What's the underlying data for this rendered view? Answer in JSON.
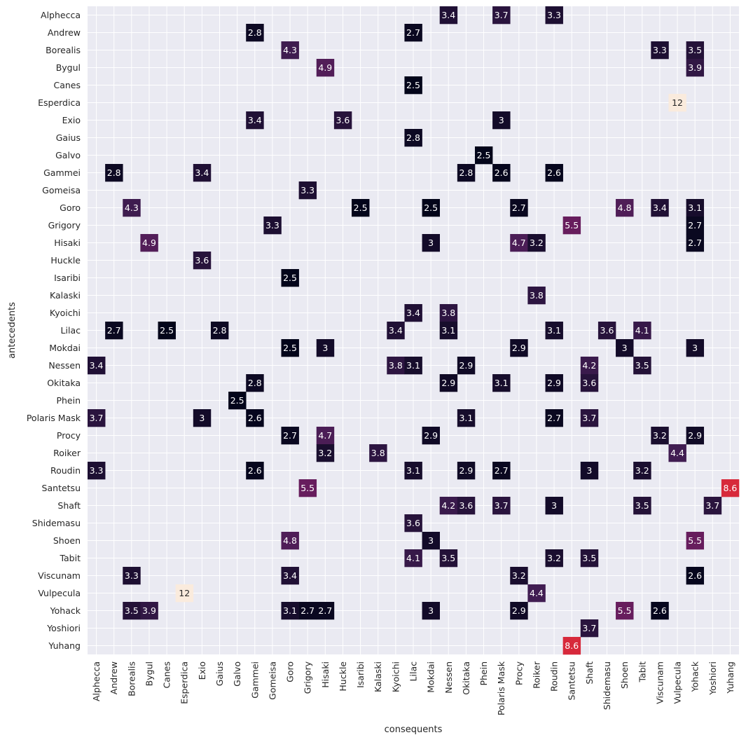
{
  "chart_data": {
    "type": "heatmap",
    "title": "",
    "xlabel": "consequents",
    "ylabel": "antecedents",
    "x_categories": [
      "Alphecca",
      "Andrew",
      "Borealis",
      "Bygul",
      "Canes",
      "Esperdica",
      "Exio",
      "Gaius",
      "Galvo",
      "Gammei",
      "Gomeisa",
      "Goro",
      "Grigory",
      "Hisaki",
      "Huckle",
      "Isaribi",
      "Kalaski",
      "Kyoichi",
      "Lilac",
      "Mokdai",
      "Nessen",
      "Okitaka",
      "Phein",
      "Polaris Mask",
      "Procy",
      "Roiker",
      "Roudin",
      "Santetsu",
      "Shaft",
      "Shidemasu",
      "Shoen",
      "Tabit",
      "Viscunam",
      "Vulpecula",
      "Yohack",
      "Yoshiori",
      "Yuhang"
    ],
    "y_categories": [
      "Alphecca",
      "Andrew",
      "Borealis",
      "Bygul",
      "Canes",
      "Esperdica",
      "Exio",
      "Gaius",
      "Galvo",
      "Gammei",
      "Gomeisa",
      "Goro",
      "Grigory",
      "Hisaki",
      "Huckle",
      "Isaribi",
      "Kalaski",
      "Kyoichi",
      "Lilac",
      "Mokdai",
      "Nessen",
      "Okitaka",
      "Phein",
      "Polaris Mask",
      "Procy",
      "Roiker",
      "Roudin",
      "Santetsu",
      "Shaft",
      "Shidemasu",
      "Shoen",
      "Tabit",
      "Viscunam",
      "Vulpecula",
      "Yohack",
      "Yoshiori",
      "Yuhang"
    ],
    "colormap": "rocket",
    "value_range": [
      2.5,
      12
    ],
    "colorbar": false,
    "grid": true,
    "cells": [
      {
        "y": "Alphecca",
        "x": "Nessen",
        "v": 3.4
      },
      {
        "y": "Alphecca",
        "x": "Polaris Mask",
        "v": 3.7
      },
      {
        "y": "Alphecca",
        "x": "Roudin",
        "v": 3.3
      },
      {
        "y": "Andrew",
        "x": "Gammei",
        "v": 2.8
      },
      {
        "y": "Andrew",
        "x": "Lilac",
        "v": 2.7
      },
      {
        "y": "Borealis",
        "x": "Goro",
        "v": 4.3
      },
      {
        "y": "Borealis",
        "x": "Viscunam",
        "v": 3.3
      },
      {
        "y": "Borealis",
        "x": "Yohack",
        "v": 3.5
      },
      {
        "y": "Bygul",
        "x": "Hisaki",
        "v": 4.9
      },
      {
        "y": "Bygul",
        "x": "Yohack",
        "v": 3.9
      },
      {
        "y": "Canes",
        "x": "Lilac",
        "v": 2.5
      },
      {
        "y": "Esperdica",
        "x": "Vulpecula",
        "v": 12
      },
      {
        "y": "Exio",
        "x": "Gammei",
        "v": 3.4
      },
      {
        "y": "Exio",
        "x": "Huckle",
        "v": 3.6
      },
      {
        "y": "Exio",
        "x": "Polaris Mask",
        "v": 3
      },
      {
        "y": "Gaius",
        "x": "Lilac",
        "v": 2.8
      },
      {
        "y": "Galvo",
        "x": "Phein",
        "v": 2.5
      },
      {
        "y": "Gammei",
        "x": "Andrew",
        "v": 2.8
      },
      {
        "y": "Gammei",
        "x": "Exio",
        "v": 3.4
      },
      {
        "y": "Gammei",
        "x": "Okitaka",
        "v": 2.8
      },
      {
        "y": "Gammei",
        "x": "Polaris Mask",
        "v": 2.6
      },
      {
        "y": "Gammei",
        "x": "Roudin",
        "v": 2.6
      },
      {
        "y": "Gomeisa",
        "x": "Grigory",
        "v": 3.3
      },
      {
        "y": "Goro",
        "x": "Borealis",
        "v": 4.3
      },
      {
        "y": "Goro",
        "x": "Isaribi",
        "v": 2.5
      },
      {
        "y": "Goro",
        "x": "Mokdai",
        "v": 2.5
      },
      {
        "y": "Goro",
        "x": "Procy",
        "v": 2.7
      },
      {
        "y": "Goro",
        "x": "Shoen",
        "v": 4.8
      },
      {
        "y": "Goro",
        "x": "Viscunam",
        "v": 3.4
      },
      {
        "y": "Goro",
        "x": "Yohack",
        "v": 3.1
      },
      {
        "y": "Grigory",
        "x": "Gomeisa",
        "v": 3.3
      },
      {
        "y": "Grigory",
        "x": "Santetsu",
        "v": 5.5
      },
      {
        "y": "Grigory",
        "x": "Yohack",
        "v": 2.7
      },
      {
        "y": "Hisaki",
        "x": "Bygul",
        "v": 4.9
      },
      {
        "y": "Hisaki",
        "x": "Mokdai",
        "v": 3
      },
      {
        "y": "Hisaki",
        "x": "Procy",
        "v": 4.7
      },
      {
        "y": "Hisaki",
        "x": "Roiker",
        "v": 3.2
      },
      {
        "y": "Hisaki",
        "x": "Yohack",
        "v": 2.7
      },
      {
        "y": "Huckle",
        "x": "Exio",
        "v": 3.6
      },
      {
        "y": "Isaribi",
        "x": "Goro",
        "v": 2.5
      },
      {
        "y": "Kalaski",
        "x": "Roiker",
        "v": 3.8
      },
      {
        "y": "Kyoichi",
        "x": "Lilac",
        "v": 3.4
      },
      {
        "y": "Kyoichi",
        "x": "Nessen",
        "v": 3.8
      },
      {
        "y": "Lilac",
        "x": "Andrew",
        "v": 2.7
      },
      {
        "y": "Lilac",
        "x": "Canes",
        "v": 2.5
      },
      {
        "y": "Lilac",
        "x": "Gaius",
        "v": 2.8
      },
      {
        "y": "Lilac",
        "x": "Kyoichi",
        "v": 3.4
      },
      {
        "y": "Lilac",
        "x": "Nessen",
        "v": 3.1
      },
      {
        "y": "Lilac",
        "x": "Roudin",
        "v": 3.1
      },
      {
        "y": "Lilac",
        "x": "Shidemasu",
        "v": 3.6
      },
      {
        "y": "Lilac",
        "x": "Tabit",
        "v": 4.1
      },
      {
        "y": "Mokdai",
        "x": "Goro",
        "v": 2.5
      },
      {
        "y": "Mokdai",
        "x": "Hisaki",
        "v": 3
      },
      {
        "y": "Mokdai",
        "x": "Procy",
        "v": 2.9
      },
      {
        "y": "Mokdai",
        "x": "Shoen",
        "v": 3
      },
      {
        "y": "Mokdai",
        "x": "Yohack",
        "v": 3
      },
      {
        "y": "Nessen",
        "x": "Alphecca",
        "v": 3.4
      },
      {
        "y": "Nessen",
        "x": "Kyoichi",
        "v": 3.8
      },
      {
        "y": "Nessen",
        "x": "Lilac",
        "v": 3.1
      },
      {
        "y": "Nessen",
        "x": "Okitaka",
        "v": 2.9
      },
      {
        "y": "Nessen",
        "x": "Shaft",
        "v": 4.2
      },
      {
        "y": "Nessen",
        "x": "Tabit",
        "v": 3.5
      },
      {
        "y": "Okitaka",
        "x": "Gammei",
        "v": 2.8
      },
      {
        "y": "Okitaka",
        "x": "Nessen",
        "v": 2.9
      },
      {
        "y": "Okitaka",
        "x": "Polaris Mask",
        "v": 3.1
      },
      {
        "y": "Okitaka",
        "x": "Roudin",
        "v": 2.9
      },
      {
        "y": "Okitaka",
        "x": "Shaft",
        "v": 3.6
      },
      {
        "y": "Phein",
        "x": "Galvo",
        "v": 2.5
      },
      {
        "y": "Polaris Mask",
        "x": "Alphecca",
        "v": 3.7
      },
      {
        "y": "Polaris Mask",
        "x": "Exio",
        "v": 3
      },
      {
        "y": "Polaris Mask",
        "x": "Gammei",
        "v": 2.6
      },
      {
        "y": "Polaris Mask",
        "x": "Okitaka",
        "v": 3.1
      },
      {
        "y": "Polaris Mask",
        "x": "Roudin",
        "v": 2.7
      },
      {
        "y": "Polaris Mask",
        "x": "Shaft",
        "v": 3.7
      },
      {
        "y": "Procy",
        "x": "Goro",
        "v": 2.7
      },
      {
        "y": "Procy",
        "x": "Hisaki",
        "v": 4.7
      },
      {
        "y": "Procy",
        "x": "Mokdai",
        "v": 2.9
      },
      {
        "y": "Procy",
        "x": "Viscunam",
        "v": 3.2
      },
      {
        "y": "Procy",
        "x": "Yohack",
        "v": 2.9
      },
      {
        "y": "Roiker",
        "x": "Hisaki",
        "v": 3.2
      },
      {
        "y": "Roiker",
        "x": "Kalaski",
        "v": 3.8
      },
      {
        "y": "Roiker",
        "x": "Vulpecula",
        "v": 4.4
      },
      {
        "y": "Roudin",
        "x": "Alphecca",
        "v": 3.3
      },
      {
        "y": "Roudin",
        "x": "Gammei",
        "v": 2.6
      },
      {
        "y": "Roudin",
        "x": "Lilac",
        "v": 3.1
      },
      {
        "y": "Roudin",
        "x": "Okitaka",
        "v": 2.9
      },
      {
        "y": "Roudin",
        "x": "Polaris Mask",
        "v": 2.7
      },
      {
        "y": "Roudin",
        "x": "Shaft",
        "v": 3
      },
      {
        "y": "Roudin",
        "x": "Tabit",
        "v": 3.2
      },
      {
        "y": "Santetsu",
        "x": "Grigory",
        "v": 5.5
      },
      {
        "y": "Santetsu",
        "x": "Yuhang",
        "v": 8.6
      },
      {
        "y": "Shaft",
        "x": "Nessen",
        "v": 4.2
      },
      {
        "y": "Shaft",
        "x": "Okitaka",
        "v": 3.6
      },
      {
        "y": "Shaft",
        "x": "Polaris Mask",
        "v": 3.7
      },
      {
        "y": "Shaft",
        "x": "Roudin",
        "v": 3
      },
      {
        "y": "Shaft",
        "x": "Tabit",
        "v": 3.5
      },
      {
        "y": "Shaft",
        "x": "Yoshiori",
        "v": 3.7
      },
      {
        "y": "Shidemasu",
        "x": "Lilac",
        "v": 3.6
      },
      {
        "y": "Shoen",
        "x": "Goro",
        "v": 4.8
      },
      {
        "y": "Shoen",
        "x": "Mokdai",
        "v": 3
      },
      {
        "y": "Shoen",
        "x": "Yohack",
        "v": 5.5
      },
      {
        "y": "Tabit",
        "x": "Lilac",
        "v": 4.1
      },
      {
        "y": "Tabit",
        "x": "Nessen",
        "v": 3.5
      },
      {
        "y": "Tabit",
        "x": "Roudin",
        "v": 3.2
      },
      {
        "y": "Tabit",
        "x": "Shaft",
        "v": 3.5
      },
      {
        "y": "Viscunam",
        "x": "Borealis",
        "v": 3.3
      },
      {
        "y": "Viscunam",
        "x": "Goro",
        "v": 3.4
      },
      {
        "y": "Viscunam",
        "x": "Procy",
        "v": 3.2
      },
      {
        "y": "Viscunam",
        "x": "Yohack",
        "v": 2.6
      },
      {
        "y": "Vulpecula",
        "x": "Esperdica",
        "v": 12
      },
      {
        "y": "Vulpecula",
        "x": "Roiker",
        "v": 4.4
      },
      {
        "y": "Yohack",
        "x": "Borealis",
        "v": 3.5
      },
      {
        "y": "Yohack",
        "x": "Bygul",
        "v": 3.9
      },
      {
        "y": "Yohack",
        "x": "Goro",
        "v": 3.1
      },
      {
        "y": "Yohack",
        "x": "Grigory",
        "v": 2.7
      },
      {
        "y": "Yohack",
        "x": "Hisaki",
        "v": 2.7
      },
      {
        "y": "Yohack",
        "x": "Mokdai",
        "v": 3
      },
      {
        "y": "Yohack",
        "x": "Procy",
        "v": 2.9
      },
      {
        "y": "Yohack",
        "x": "Shoen",
        "v": 5.5
      },
      {
        "y": "Yohack",
        "x": "Viscunam",
        "v": 2.6
      },
      {
        "y": "Yoshiori",
        "x": "Shaft",
        "v": 3.7
      },
      {
        "y": "Yuhang",
        "x": "Santetsu",
        "v": 8.6
      }
    ]
  }
}
